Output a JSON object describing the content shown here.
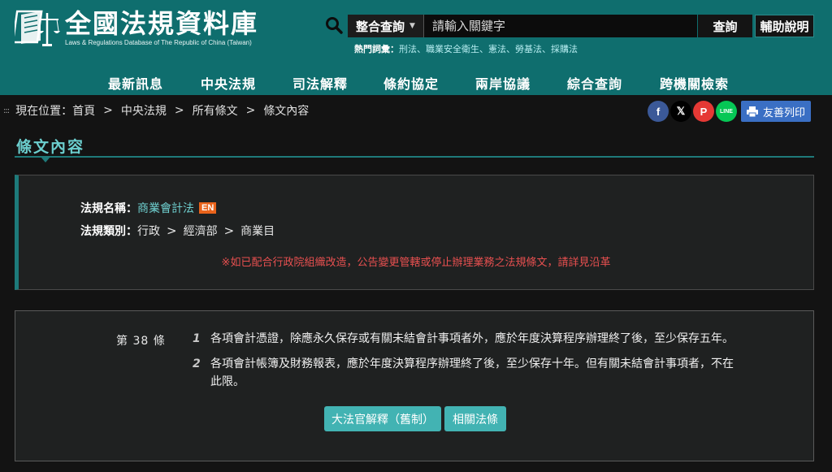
{
  "site": {
    "title": "全國法規資料庫",
    "subtitle": "Laws & Regulations Database of The Republic of China (Taiwan)"
  },
  "search": {
    "scope_label": "整合查詢",
    "placeholder": "請輸入關鍵字",
    "submit_label": "查詢",
    "help_label": "輔助說明",
    "hot_label": "熱門詞彙：",
    "hot_terms": [
      "刑法",
      "職業安全衛生",
      "憲法",
      "勞基法",
      "採購法"
    ]
  },
  "nav": {
    "items": [
      "最新訊息",
      "中央法規",
      "司法解釋",
      "條約協定",
      "兩岸協議",
      "綜合查詢",
      "跨機關檢索"
    ]
  },
  "breadcrumb": {
    "dots": ":::",
    "prefix": "現在位置：",
    "items": [
      "首頁",
      "中央法規",
      "所有條文",
      "條文內容"
    ],
    "sep": ">"
  },
  "share": {
    "icons": [
      "facebook-icon",
      "x-icon",
      "plurk-icon",
      "line-icon"
    ],
    "glyphs": [
      "f",
      "𝕏",
      "P",
      "LINE"
    ],
    "colors": [
      "#3b5998",
      "#000000",
      "#e53935",
      "#06c755"
    ],
    "print_label": "友善列印"
  },
  "section": {
    "title": "條文內容"
  },
  "law": {
    "name_label": "法規名稱：",
    "name": "商業會計法",
    "en_badge": "EN",
    "category_label": "法規類別：",
    "category": [
      "行政",
      "經濟部",
      "商業目"
    ],
    "category_sep": ">",
    "notice": "※如已配合行政院組織改造，公告變更管轄或停止辦理業務之法規條文，請詳見沿革"
  },
  "article": {
    "number": "第 38 條",
    "paragraphs": [
      {
        "no": "1",
        "text": "各項會計憑證，除應永久保存或有關未結會計事項者外，應於年度決算程序辦理終了後，至少保存五年。"
      },
      {
        "no": "2",
        "text": "各項會計帳簿及財務報表，應於年度決算程序辦理終了後，至少保存十年。但有關未結會計事項者，不在此限。"
      }
    ],
    "interpretation_button": "大法官解釋（舊制）",
    "related_button": "相關法條"
  },
  "colors": {
    "header_bg": "#0f6e6e",
    "accent": "#6ccfcf",
    "button_teal": "#42b3b3",
    "notice_red": "#e85050",
    "en_badge": "#e9631b",
    "print_blue": "#3a6fc4"
  }
}
